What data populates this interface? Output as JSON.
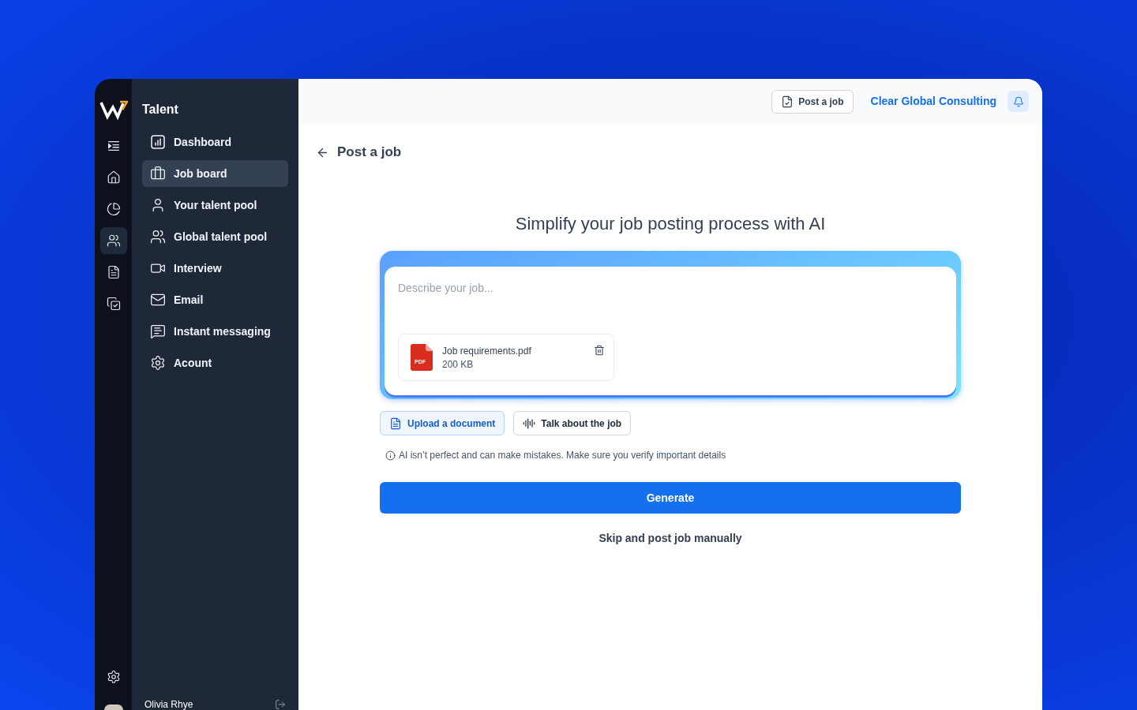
{
  "rail": {
    "items": [
      {
        "selected": false
      },
      {
        "selected": false
      },
      {
        "selected": false
      },
      {
        "selected": true
      },
      {
        "selected": false
      },
      {
        "selected": false
      }
    ]
  },
  "sidebar": {
    "title": "Talent",
    "items": [
      {
        "label": "Dashboard",
        "selected": false
      },
      {
        "label": "Job board",
        "selected": true
      },
      {
        "label": "Your talent pool",
        "selected": false
      },
      {
        "label": "Global talent pool",
        "selected": false
      },
      {
        "label": "Interview",
        "selected": false
      },
      {
        "label": "Email",
        "selected": false
      },
      {
        "label": "Instant messaging",
        "selected": false
      },
      {
        "label": "Acount",
        "selected": false
      }
    ]
  },
  "user": {
    "name": "Olivia Rhye"
  },
  "header": {
    "post_button": "Post a job",
    "company": "Clear Global Consulting"
  },
  "page": {
    "title": "Post a job",
    "heading": "Simplify your job posting process with AI",
    "prompt": {
      "placeholder": "Describe your job..."
    },
    "attachment": {
      "badge": "PDF",
      "file_name": "Job requirements.pdf",
      "size": "200 KB"
    },
    "actions": [
      {
        "label": "Upload a document",
        "selected": true
      },
      {
        "label": "Talk about the job",
        "selected": false
      }
    ],
    "notice": "AI isn’t perfect and can make mistakes. Make sure you verify important details",
    "generate": "Generate",
    "skip": "Skip and post job manually"
  }
}
